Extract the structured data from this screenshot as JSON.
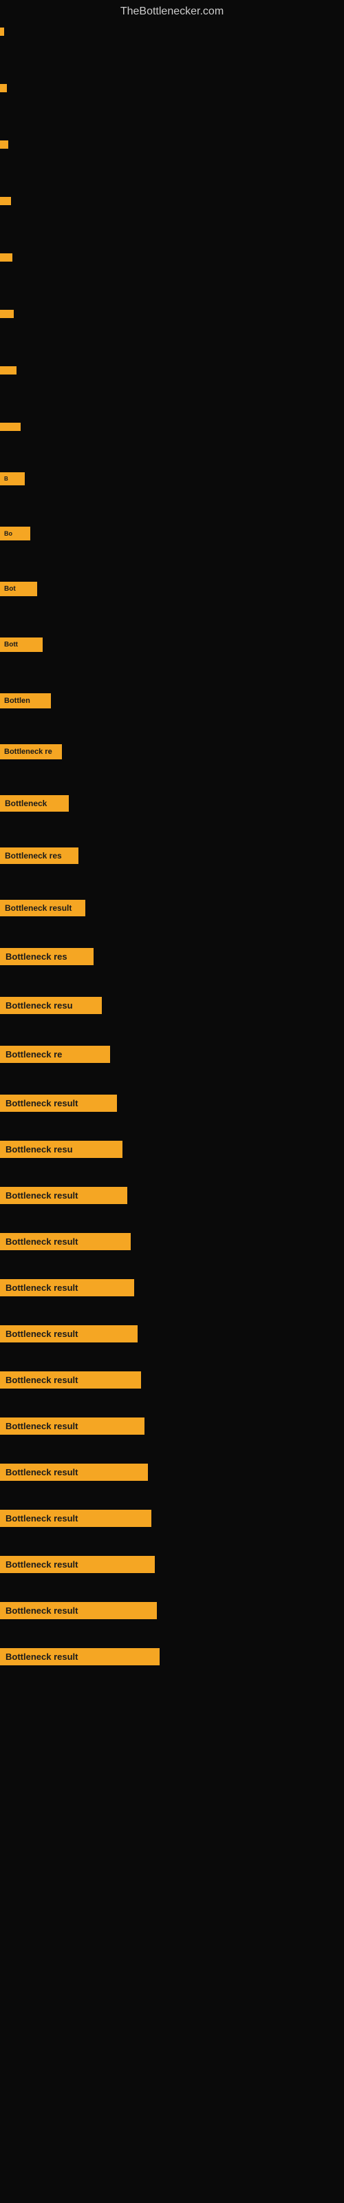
{
  "site": {
    "title": "TheBottlenecker.com"
  },
  "items": [
    {
      "index": 0,
      "label": ""
    },
    {
      "index": 1,
      "label": ""
    },
    {
      "index": 2,
      "label": ""
    },
    {
      "index": 3,
      "label": ""
    },
    {
      "index": 4,
      "label": ""
    },
    {
      "index": 5,
      "label": ""
    },
    {
      "index": 6,
      "label": ""
    },
    {
      "index": 7,
      "label": ""
    },
    {
      "index": 8,
      "label": "B"
    },
    {
      "index": 9,
      "label": "Bo"
    },
    {
      "index": 10,
      "label": "Bot"
    },
    {
      "index": 11,
      "label": "Bott"
    },
    {
      "index": 12,
      "label": "Bottlen"
    },
    {
      "index": 13,
      "label": "Bottleneck re"
    },
    {
      "index": 14,
      "label": "Bottleneck"
    },
    {
      "index": 15,
      "label": "Bottleneck res"
    },
    {
      "index": 16,
      "label": "Bottleneck result"
    },
    {
      "index": 17,
      "label": "Bottleneck res"
    },
    {
      "index": 18,
      "label": "Bottleneck resu"
    },
    {
      "index": 19,
      "label": "Bottleneck re"
    },
    {
      "index": 20,
      "label": "Bottleneck result"
    },
    {
      "index": 21,
      "label": "Bottleneck resu"
    },
    {
      "index": 22,
      "label": "Bottleneck result"
    },
    {
      "index": 23,
      "label": "Bottleneck result"
    },
    {
      "index": 24,
      "label": "Bottleneck result"
    },
    {
      "index": 25,
      "label": "Bottleneck result"
    },
    {
      "index": 26,
      "label": "Bottleneck result"
    },
    {
      "index": 27,
      "label": "Bottleneck result"
    },
    {
      "index": 28,
      "label": "Bottleneck result"
    },
    {
      "index": 29,
      "label": "Bottleneck result"
    },
    {
      "index": 30,
      "label": "Bottleneck result"
    },
    {
      "index": 31,
      "label": "Bottleneck result"
    },
    {
      "index": 32,
      "label": "Bottleneck result"
    }
  ]
}
